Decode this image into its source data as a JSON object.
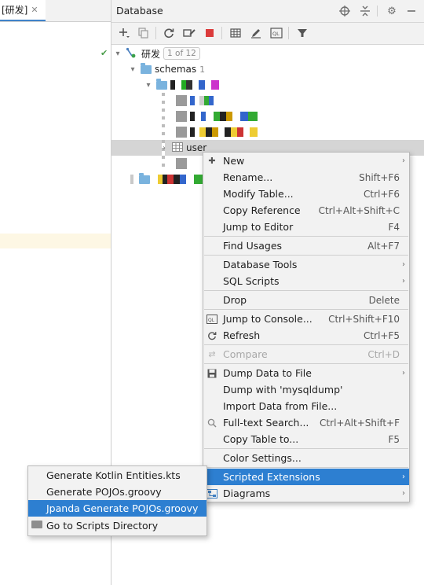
{
  "editor_tab": {
    "label": "[研发]",
    "close": "✕"
  },
  "database_panel": {
    "title": "Database",
    "tree": {
      "root_label": "研发",
      "root_badge": "1 of 12",
      "schemas_label": "schemas",
      "schemas_count": "1",
      "selected_table": "user"
    }
  },
  "context_menu": {
    "items": [
      {
        "label": "New",
        "shortcut": "",
        "submenu": true
      },
      {
        "label": "Rename...",
        "shortcut": "Shift+F6"
      },
      {
        "label": "Modify Table...",
        "shortcut": "Ctrl+F6"
      },
      {
        "label": "Copy Reference",
        "shortcut": "Ctrl+Alt+Shift+C"
      },
      {
        "label": "Jump to Editor",
        "shortcut": "F4"
      },
      {
        "label": "Find Usages",
        "shortcut": "Alt+F7"
      },
      {
        "label": "Database Tools",
        "submenu": true
      },
      {
        "label": "SQL Scripts",
        "submenu": true
      },
      {
        "label": "Drop",
        "shortcut": "Delete"
      },
      {
        "label": "Jump to Console...",
        "shortcut": "Ctrl+Shift+F10"
      },
      {
        "label": "Refresh",
        "shortcut": "Ctrl+F5"
      },
      {
        "label": "Compare",
        "shortcut": "Ctrl+D",
        "disabled": true
      },
      {
        "label": "Dump Data to File",
        "submenu": true
      },
      {
        "label": "Dump with 'mysqldump'"
      },
      {
        "label": "Import Data from File..."
      },
      {
        "label": "Full-text Search...",
        "shortcut": "Ctrl+Alt+Shift+F"
      },
      {
        "label": "Copy Table to...",
        "shortcut": "F5"
      },
      {
        "label": "Color Settings..."
      },
      {
        "label": "Scripted Extensions",
        "submenu": true,
        "highlighted": true
      },
      {
        "label": "Diagrams",
        "submenu": true
      }
    ]
  },
  "scripted_extensions_submenu": {
    "items": [
      {
        "label": "Generate Kotlin Entities.kts"
      },
      {
        "label": "Generate POJOs.groovy"
      },
      {
        "label": "Jpanda Generate POJOs.groovy",
        "highlighted": true
      },
      {
        "label": "Go to Scripts Directory"
      }
    ]
  },
  "colors": {
    "selection": "#2d7fd1",
    "folder": "#7ab3de",
    "stop_red": "#db3b3b"
  }
}
